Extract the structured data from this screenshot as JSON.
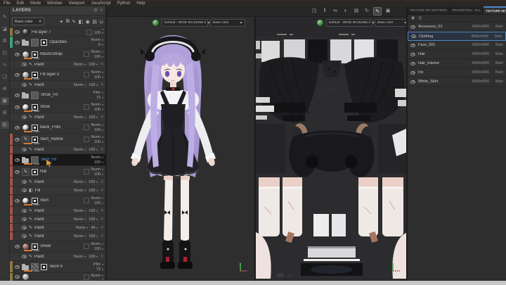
{
  "colors": {
    "accent_blue": "#4e86c8",
    "selection_text": "#6b9fe4",
    "orange_bar": "#d9782d",
    "tag_red": "#a6544a",
    "tag_olive": "#8c7a3e",
    "tag_teal": "#3fa37a"
  },
  "glyphs": {
    "close_effect": "×",
    "paint_effect": "✎",
    "fill_effect": "◧"
  },
  "menu_bar": {
    "items": [
      "File",
      "Edit",
      "Mode",
      "Window",
      "Viewport",
      "JavaScript",
      "Python",
      "Help"
    ]
  },
  "left_toolbar": {
    "tools": [
      {
        "name": "paint-tool",
        "glyph": "✎",
        "hl": false
      },
      {
        "name": "eraser-tool",
        "glyph": "◪",
        "hl": false
      },
      {
        "name": "projection-tool",
        "glyph": "⧉",
        "hl": false
      },
      {
        "name": "polygon-fill-tool",
        "glyph": "◰",
        "hl": false
      },
      {
        "name": "smudge-tool",
        "glyph": "∿",
        "hl": false
      },
      {
        "name": "clone-tool",
        "glyph": "❏",
        "hl": false
      },
      {
        "name": "material-picker-tool",
        "glyph": "⊕",
        "hl": false
      },
      {
        "name": "geometry-mask-tool",
        "glyph": "◍",
        "hl": true
      },
      {
        "name": "quick-mask-tool",
        "glyph": "⊞",
        "hl": false
      },
      {
        "name": "viewer-settings-tool",
        "glyph": "◴",
        "hl": true
      }
    ]
  },
  "layers_panel": {
    "title": "LAYERS",
    "channel_selector": "Base color",
    "window_icons": [
      {
        "name": "dock-panel-icon",
        "glyph": "⊡"
      },
      {
        "name": "close-panel-icon",
        "glyph": "×"
      }
    ],
    "toolbar_icons": [
      {
        "name": "add-effect-icon",
        "glyph": "✦"
      },
      {
        "name": "add-stencil-icon",
        "glyph": "⧉"
      },
      {
        "name": "add-paint-layer-icon",
        "glyph": "✎"
      },
      {
        "name": "add-fill-layer-icon",
        "glyph": "◧"
      },
      {
        "name": "add-smart-material-icon",
        "glyph": "◉"
      },
      {
        "name": "add-group-icon",
        "glyph": "▤"
      },
      {
        "name": "delete-layer-icon",
        "glyph": "⊔"
      }
    ],
    "layers": [
      {
        "type": "main",
        "name": "Fill layer 7",
        "blend": "",
        "opacity": "100",
        "thumb": "sphere-dark",
        "mask": false,
        "tag": "olive",
        "bars": false,
        "partial": true
      },
      {
        "type": "group",
        "name": "Opacities",
        "blend": "Norm",
        "opacity": "0",
        "mask": true,
        "tag": "teal",
        "bars": false
      },
      {
        "type": "main",
        "name": "MasticStrap",
        "blend": "Norm",
        "opacity": "100",
        "thumb": "sphere-light",
        "mask": true,
        "tag": null,
        "bars": true
      },
      {
        "type": "effect",
        "name": "Paint",
        "icon": "paint",
        "blend": "Norm",
        "opacity": "100",
        "tag": null
      },
      {
        "type": "main",
        "name": "Fill layer 5",
        "blend": "Norm",
        "opacity": "100",
        "thumb": "sphere-light",
        "mask": true,
        "tag": null,
        "bars": true
      },
      {
        "type": "effect",
        "name": "Paint",
        "icon": "paint",
        "blend": "Norm",
        "opacity": "100",
        "tag": null
      },
      {
        "type": "group",
        "name": "Shoe_Fit",
        "blend": "Pthr",
        "opacity": "72",
        "mask": false,
        "tag": null,
        "bars": false
      },
      {
        "type": "main",
        "name": "Shoe",
        "blend": "Norm",
        "opacity": "100",
        "thumb": "sphere-bw",
        "mask": true,
        "tag": null,
        "bars": true
      },
      {
        "type": "effect",
        "name": "Paint",
        "icon": "paint",
        "blend": "Norm",
        "opacity": "100",
        "tag": null
      },
      {
        "type": "main",
        "name": "Back_Frills",
        "blend": "Norm",
        "opacity": "100",
        "thumb": "sphere-bw",
        "mask": true,
        "tag": null,
        "bars": true
      },
      {
        "type": "main",
        "name": "Skirt_Refine",
        "blend": "Norm",
        "opacity": "100",
        "thumb": "paint",
        "mask": true,
        "tag": "red",
        "bars": true
      },
      {
        "type": "effect",
        "name": "Paint",
        "icon": "paint",
        "blend": "Norm",
        "opacity": "100",
        "tag": "red"
      },
      {
        "type": "group",
        "name": "Skirt_Fit",
        "blend": "Norm",
        "opacity": "100",
        "mask": false,
        "tag": "red",
        "bars": true,
        "selected": true,
        "cursor": true
      },
      {
        "type": "main",
        "name": "Hat",
        "blend": "Norm",
        "opacity": "100",
        "thumb": "paint",
        "mask": true,
        "tag": "red",
        "bars": false
      },
      {
        "type": "effect",
        "name": "Paint",
        "icon": "paint",
        "blend": "Norm",
        "opacity": "100",
        "tag": "red"
      },
      {
        "type": "effect",
        "name": "Fill",
        "icon": "fill",
        "blend": "Norm",
        "opacity": "100",
        "tag": "red"
      },
      {
        "type": "main",
        "name": "Skirt",
        "blend": "Norm",
        "opacity": "100",
        "thumb": "sphere-bw",
        "mask": true,
        "tag": "red",
        "bars": true
      },
      {
        "type": "effect",
        "name": "Paint",
        "icon": "paint",
        "blend": "Norm",
        "opacity": "100",
        "tag": "red"
      },
      {
        "type": "effect",
        "name": "Paint",
        "icon": "paint",
        "blend": "Norm",
        "opacity": "100",
        "tag": "red"
      },
      {
        "type": "effect",
        "name": "Paint",
        "icon": "paint",
        "blend": "Norm",
        "opacity": "44",
        "tag": "red"
      },
      {
        "type": "effect",
        "name": "Paint",
        "icon": "paint",
        "blend": "Norm",
        "opacity": "100",
        "tag": "red"
      },
      {
        "type": "main",
        "name": "Sheer",
        "blend": "Norm",
        "opacity": "100",
        "thumb": "sphere-red",
        "mask": true,
        "tag": null,
        "bars": true
      },
      {
        "type": "effect",
        "name": "Paint",
        "icon": "paint",
        "blend": "Norm",
        "opacity": "100",
        "tag": null
      },
      {
        "type": "group",
        "name": "SkinFX",
        "blend": "Pthr",
        "opacity": "73",
        "mask": true,
        "tag": "olive",
        "bars": true,
        "checker": true
      },
      {
        "type": "main",
        "name": "",
        "blend": "Norm",
        "opacity": "",
        "thumb": "sphere-light",
        "mask": false,
        "tag": "olive",
        "bars": false,
        "partial": true
      }
    ]
  },
  "viewport_toolbar": {
    "icons": [
      {
        "name": "display-settings-icon",
        "glyph": "◳",
        "active": false
      },
      {
        "name": "pause-engine-icon",
        "glyph": "‖",
        "active": false
      },
      {
        "name": "symmetry-icon",
        "glyph": "⇋",
        "active": false
      },
      {
        "name": "environment-icon",
        "glyph": "◐",
        "active": false
      },
      {
        "name": "camera-icon",
        "glyph": "▤",
        "active": false
      },
      {
        "name": "rotate-view-icon",
        "glyph": "↻",
        "active": false
      },
      {
        "name": "paint-mode-icon",
        "glyph": "✎",
        "active": true
      },
      {
        "name": "screenshot-icon",
        "glyph": "▣",
        "active": false
      }
    ]
  },
  "viewport_3d": {
    "colorspace_selector": "Default - sRGB IEC61966-2",
    "channel_selector": "Base color"
  },
  "viewport_2d": {
    "colorspace_selector": "Default - sRGB IEC61966-2",
    "channel_selector": "Base color"
  },
  "right_panel": {
    "tabs": [
      {
        "label": "TEXTURE SET SETTINGS",
        "active": false
      },
      {
        "label": "PROPERTIES - FILL",
        "active": false
      },
      {
        "label": "TEXTURE SET LIST",
        "active": true
      }
    ],
    "close_icon": "×",
    "filter_icons": [
      {
        "name": "show-all-sets-icon",
        "glyph": "◉"
      },
      {
        "name": "isolate-set-icon",
        "glyph": "◎"
      }
    ],
    "texture_sets": [
      {
        "name": "Accessory_01",
        "size": "4096x4096",
        "shader": "Main",
        "selected": false
      },
      {
        "name": "Clothing",
        "size": "4096x4096",
        "shader": "Main",
        "selected": true
      },
      {
        "name": "Face_001",
        "size": "4096x4096",
        "shader": "Main",
        "selected": false
      },
      {
        "name": "Hair",
        "size": "4096x4096",
        "shader": "Main",
        "selected": false
      },
      {
        "name": "Hair_Interior",
        "size": "4096x4096",
        "shader": "Main",
        "selected": false
      },
      {
        "name": "Iris",
        "size": "4096x4096",
        "shader": "Main",
        "selected": false
      },
      {
        "name": "White_Skirt",
        "size": "4096x4096",
        "shader": "Main",
        "selected": false
      }
    ]
  }
}
